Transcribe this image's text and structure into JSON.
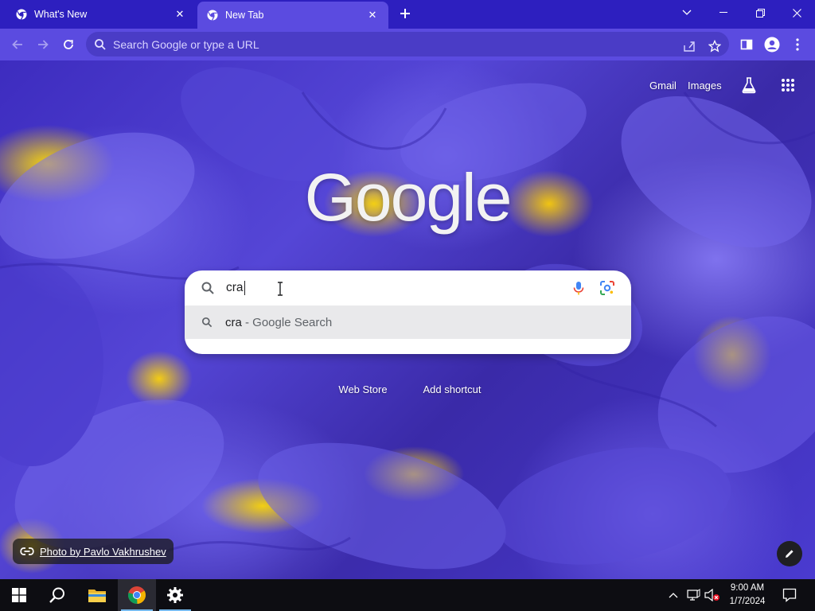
{
  "browser": {
    "tabs": [
      {
        "title": "What's New",
        "active": false
      },
      {
        "title": "New Tab",
        "active": true
      }
    ],
    "omnibox_placeholder": "Search Google or type a URL"
  },
  "ntp": {
    "top_links": {
      "gmail": "Gmail",
      "images": "Images"
    },
    "logo_text": "Google",
    "search": {
      "query": "cra",
      "suggestion_query": "cra",
      "suggestion_suffix": " - Google Search"
    },
    "shortcuts": [
      {
        "label": "Web Store"
      },
      {
        "label": "Add shortcut"
      }
    ],
    "photo_credit": "Photo by Pavlo Vakhrushev"
  },
  "taskbar": {
    "time": "9:00 AM",
    "date": "1/7/2024"
  },
  "colors": {
    "tabstrip": "#2d1fbf",
    "toolbar": "#5b4be0",
    "taskbar": "#0d0d12"
  }
}
